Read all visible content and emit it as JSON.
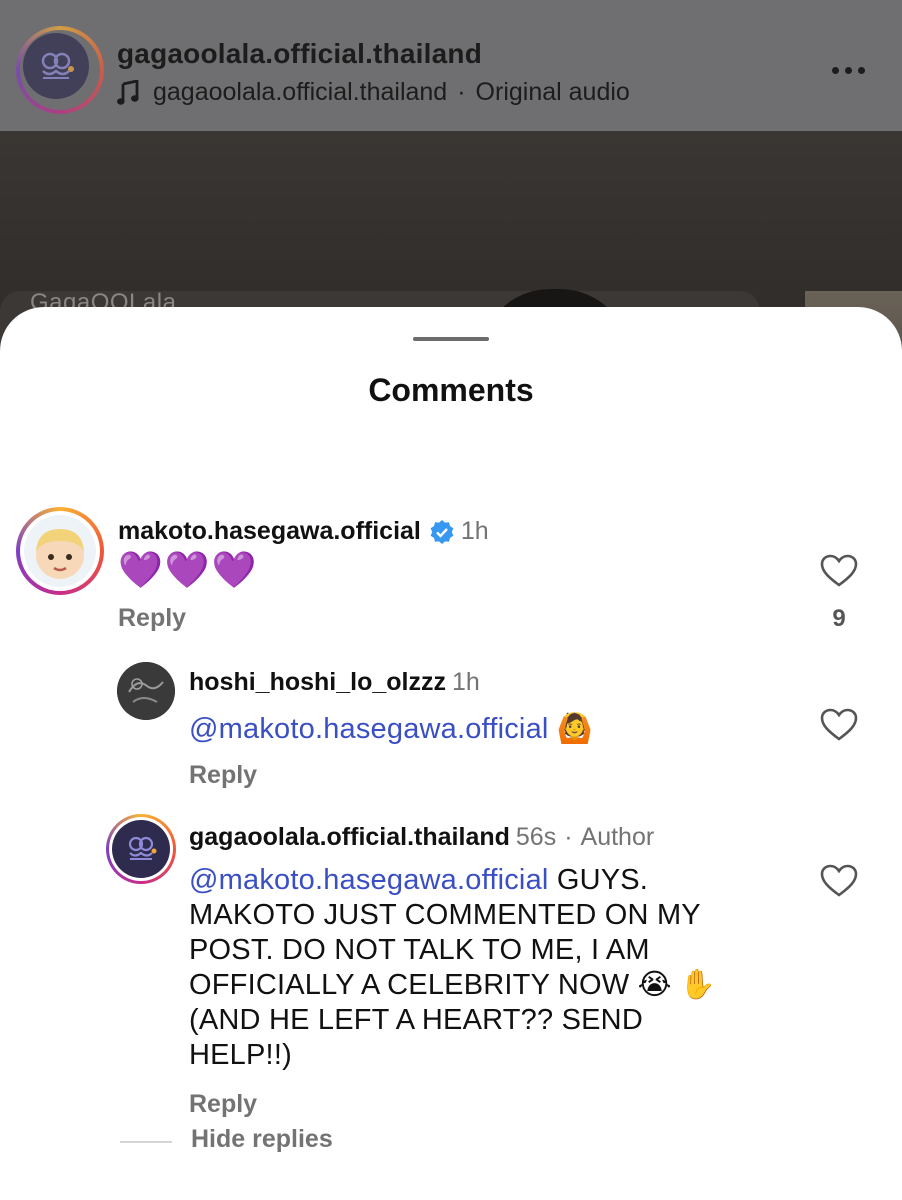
{
  "post": {
    "username": "gagaoolala.official.thailand",
    "audio_user": "gagaoolala.official.thailand",
    "audio_separator": "·",
    "audio_label": "Original audio",
    "watermark": "GagaOOLala"
  },
  "sheet": {
    "title": "Comments"
  },
  "comments": [
    {
      "username": "makoto.hasegawa.official",
      "verified": true,
      "time": "1h",
      "text": "💜💜💜",
      "reply_label": "Reply",
      "like_count": "9"
    },
    {
      "username": "hoshi_hoshi_lo_olzzz",
      "time": "1h",
      "mention": "@makoto.hasegawa.official",
      "text": "🙆",
      "reply_label": "Reply"
    },
    {
      "username": "gagaoolala.official.thailand",
      "time": "56s",
      "separator": "·",
      "author_label": "Author",
      "mention": "@makoto.hasegawa.official",
      "text_line1": "GUYS.",
      "text_line2": "MAKOTO JUST COMMENTED ON MY",
      "text_line3": "POST. DO NOT TALK TO ME, I AM",
      "text_line4": "OFFICIALLY A CELEBRITY NOW 😭 ✋",
      "text_line5": "(AND HE LEFT A HEART?? SEND",
      "text_line6": "HELP!!)",
      "reply_label": "Reply"
    }
  ],
  "hide_replies_label": "Hide replies",
  "colors": {
    "mention": "#3b4fc4",
    "muted": "#737373",
    "verified": "#3897f0"
  }
}
